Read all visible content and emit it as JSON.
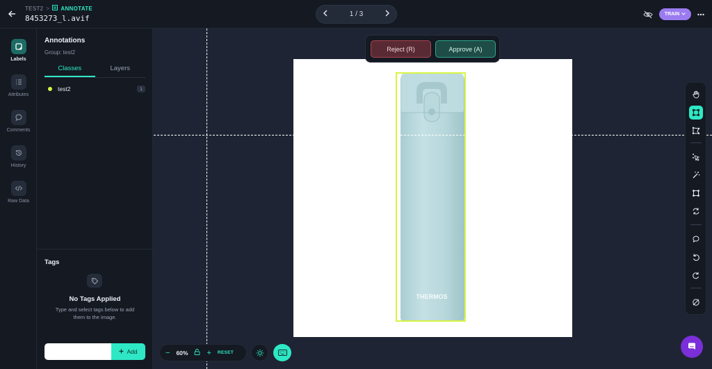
{
  "header": {
    "breadcrumb_project": "TEST2",
    "breadcrumb_separator": ">",
    "breadcrumb_mode": "ANNOTATE",
    "filename": "8453273_l.avif",
    "pager": "1 / 3",
    "mode_badge": "TRAIN"
  },
  "rail": {
    "items": [
      {
        "label": "Labels",
        "icon": "tag-icon"
      },
      {
        "label": "Attributes",
        "icon": "list-icon"
      },
      {
        "label": "Comments",
        "icon": "comment-icon"
      },
      {
        "label": "History",
        "icon": "history-icon"
      },
      {
        "label": "Raw Data",
        "icon": "code-icon"
      }
    ]
  },
  "panel": {
    "title": "Annotations",
    "group_label": "Group: test2",
    "tabs": [
      "Classes",
      "Layers"
    ],
    "classes": [
      {
        "name": "test2",
        "count": "1",
        "color": "#d8f542"
      }
    ],
    "tags_title": "Tags",
    "no_tags_title": "No Tags Applied",
    "no_tags_help": "Type and select tags below to add them to the image.",
    "tag_input_placeholder": "",
    "add_label": "Add"
  },
  "review": {
    "reject_label": "Reject (R)",
    "approve_label": "Approve (A)"
  },
  "zoom": {
    "minus": "−",
    "value": "60%",
    "plus": "+",
    "reset_label": "RESET"
  },
  "colors": {
    "accent": "#2ee8c5",
    "bbox": "#d8f542",
    "train_badge": "#9b7bf0",
    "chat": "#7a2fd8"
  }
}
